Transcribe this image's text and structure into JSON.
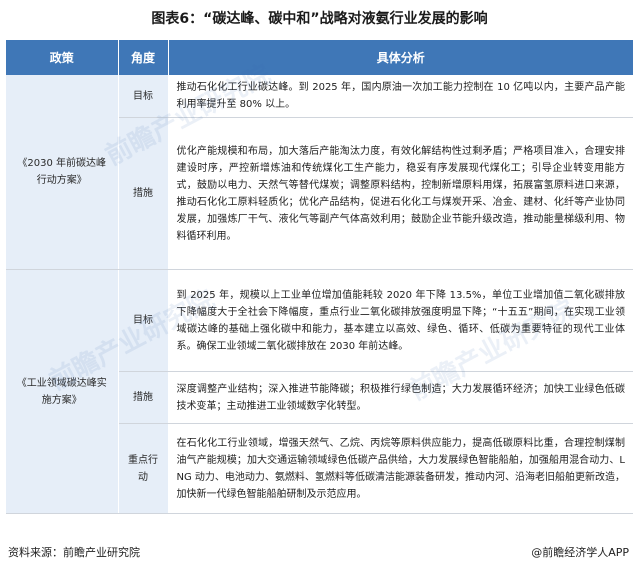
{
  "title": "图表6：“碳达峰、碳中和”战略对液氨行业发展的影响",
  "table": {
    "headers": [
      "政策",
      "角度",
      "具体分析"
    ],
    "groups": [
      {
        "policy": "《2030 年前碳达峰行动方案》",
        "rows": [
          {
            "angle": "目标",
            "detail": "推动石化化工行业碳达峰。到 2025 年，国内原油一次加工能力控制在 10 亿吨以内，主要产品产能利用率提升至 80% 以上。"
          },
          {
            "angle": "措施",
            "detail": "优化产能规模和布局，加大落后产能淘汰力度，有效化解结构性过剩矛盾；严格项目准入，合理安排建设时序，严控新增炼油和传统煤化工生产能力，稳妥有序发展现代煤化工；引导企业转变用能方式，鼓励以电力、天然气等替代煤炭；调整原料结构，控制新增原料用煤，拓展富氢原料进口来源，推动石化化工原料轻质化；优化产品结构，促进石化化工与煤炭开采、冶金、建材、化纤等产业协同发展，加强炼厂干气、液化气等副产气体高效利用；鼓励企业节能升级改造，推动能量梯级利用、物料循环利用。"
          }
        ]
      },
      {
        "policy": "《工业领域碳达峰实施方案》",
        "rows": [
          {
            "angle": "目标",
            "detail": "到 2025 年，规模以上工业单位增加值能耗较 2020 年下降 13.5%，单位工业增加值二氧化碳排放下降幅度大于全社会下降幅度，重点行业二氧化碳排放强度明显下降；“十五五”期间，在实现工业领域碳达峰的基础上强化碳中和能力，基本建立以高效、绿色、循环、低碳为重要特征的现代工业体系。确保工业领域二氧化碳排放在 2030 年前达峰。"
          },
          {
            "angle": "措施",
            "detail": "深度调整产业结构；深入推进节能降碳；积极推行绿色制造；大力发展循环经济；加快工业绿色低碳技术变革；主动推进工业领域数字化转型。"
          },
          {
            "angle": "重点行动",
            "detail": "在石化化工行业领域，增强天然气、乙烷、丙烷等原料供应能力，提高低碳原料比重，合理控制煤制油气产能规模；加大交通运输领域绿色低碳产品供给，大力发展绿色智能船舶，加强船用混合动力、LNG 动力、电池动力、氨燃料、氢燃料等低碳清洁能源装备研发，推动内河、沿海老旧船舶更新改造，加快新一代绿色智能船舶研制及示范应用。"
          }
        ]
      }
    ]
  },
  "footer": {
    "source": "资料来源：前瞻产业研究院",
    "app": "@前瞻经济学人APP"
  },
  "watermark": {
    "text": "前瞻产业研究院"
  },
  "colors": {
    "header_bg": "#3f77b7",
    "label_bg": "#e6eef8"
  }
}
